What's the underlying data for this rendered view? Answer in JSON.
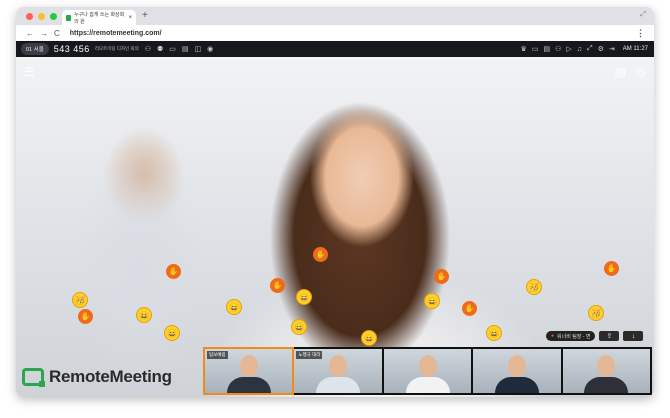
{
  "browser": {
    "tab_title": "누구나 쉽게 쓰는 화상회의 원",
    "tab_close": "×",
    "new_tab": "+",
    "url": "https://remotemeeting.com/",
    "nav": [
      "←",
      "→",
      "C"
    ],
    "menu": "⋮",
    "expand": "⤢",
    "dot_colors": [
      "#fe5f57",
      "#febc2e",
      "#28c840"
    ]
  },
  "toolbar": {
    "room_badge": "01  서울",
    "meeting_id": "543 456",
    "meeting_title": "리모트미팅 디자인 회의",
    "left_icons": [
      "users-icon",
      "user-add-icon",
      "screen-share-icon",
      "document-icon",
      "camera-icon",
      "record-icon"
    ],
    "right_icons": [
      "crown-icon",
      "layout-icon",
      "chat-icon",
      "participants-icon",
      "video-icon",
      "mic-icon",
      "fullscreen-icon",
      "settings-icon",
      "exit-icon"
    ],
    "time": "AM 11:27"
  },
  "video": {
    "left_icon": "list-icon",
    "right_icons": [
      "layers-icon",
      "zoom-icon"
    ],
    "logo_text": "RemoteMeeting",
    "speaker_label": "워너비 팀장 - 변",
    "controls": [
      "share-icon",
      "download-icon"
    ],
    "thumbnails": [
      {
        "name": "팀보예림"
      },
      {
        "name": "노행규 대리"
      },
      {
        "name": ""
      },
      {
        "name": ""
      },
      {
        "name": ""
      }
    ]
  }
}
